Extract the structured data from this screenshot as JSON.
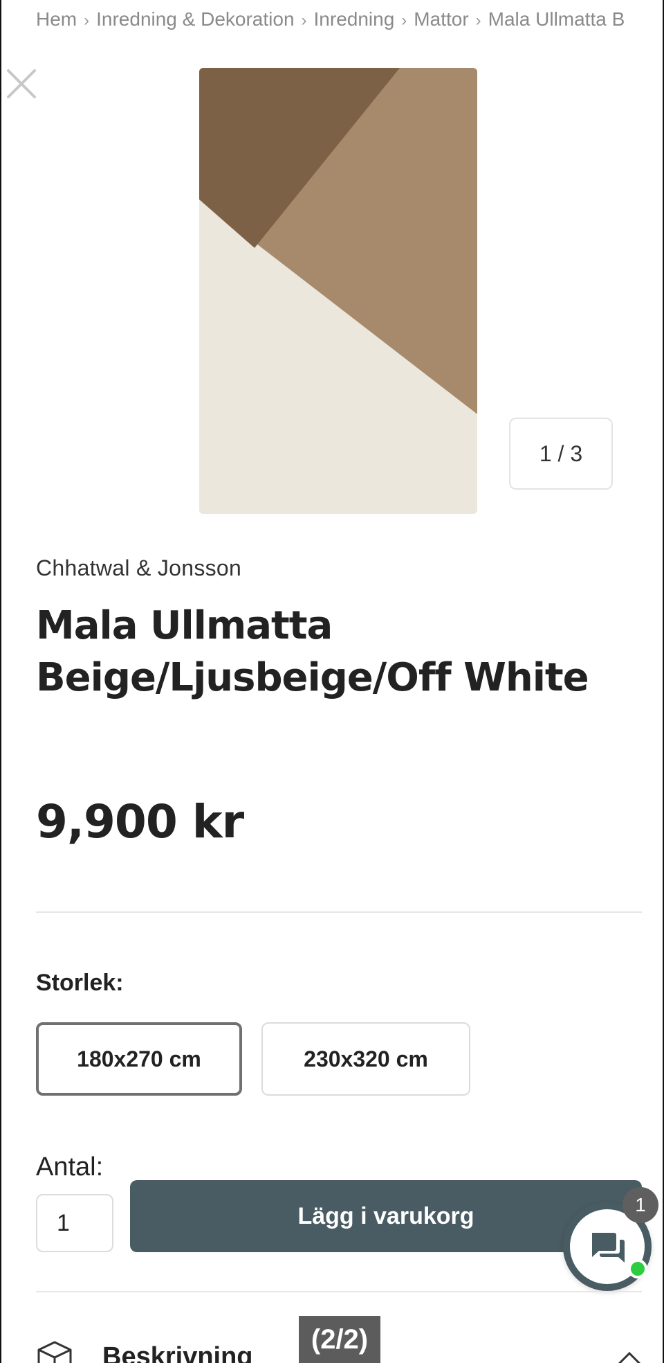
{
  "breadcrumb": {
    "items": [
      "Hem",
      "Inredning & Dekoration",
      "Inredning",
      "Mattor",
      "Mala Ullmatta B"
    ],
    "separator": "›"
  },
  "gallery": {
    "counter": "1 / 3",
    "close_icon": "close-icon",
    "colors": {
      "dark": "#7d6147",
      "mid": "#a78a6b",
      "light": "#ece7dd"
    }
  },
  "product": {
    "brand": "Chhatwal & Jonsson",
    "title_line1": "Mala Ullmatta",
    "title_line2": "Beige/Ljusbeige/Off White",
    "price": "9,900 kr"
  },
  "size": {
    "label": "Storlek:",
    "options": [
      "180x270 cm",
      "230x320 cm"
    ],
    "selected": "180x270 cm"
  },
  "quantity": {
    "label": "Antal:",
    "value": "1"
  },
  "cart": {
    "add_label": "Lägg i varukorg",
    "accent": "#4a5c63"
  },
  "chat": {
    "icon": "chat-icon",
    "badge_count": "1",
    "online_color": "#2ecc40"
  },
  "description": {
    "label": "Beskrivning",
    "icon": "box-icon"
  },
  "overlay": {
    "page_indicator": "(2/2)"
  }
}
